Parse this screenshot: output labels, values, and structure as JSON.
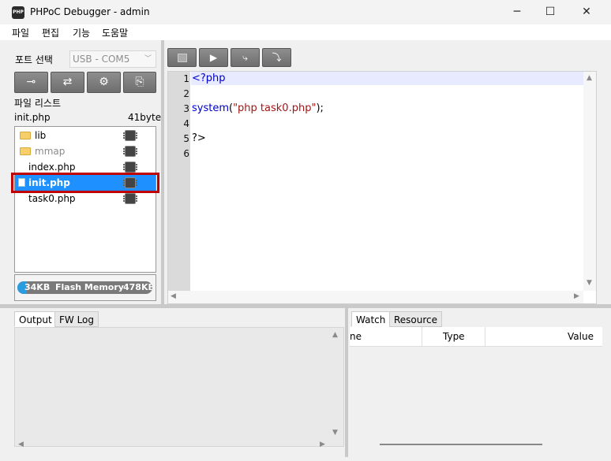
{
  "window": {
    "app_icon_text": "PHP",
    "title": "PHPoC Debugger - admin",
    "minimize": "─",
    "maximize": "☐",
    "close": "✕"
  },
  "menu": {
    "items": [
      "파일",
      "편집",
      "기능",
      "도움말"
    ]
  },
  "port": {
    "label": "포트 선택",
    "value": "USB - COM5"
  },
  "toolbar": {
    "icons": [
      "disconnect-icon",
      "connect-icon",
      "settings-icon",
      "upload-icon"
    ]
  },
  "file_list": {
    "label": "파일 리스트",
    "current_file": "init.php",
    "current_size": "41byte",
    "items": [
      {
        "name": "lib",
        "type": "folder"
      },
      {
        "name": "mmap",
        "type": "folder"
      },
      {
        "name": "index.php",
        "type": "file"
      },
      {
        "name": "init.php",
        "type": "file",
        "selected": true
      },
      {
        "name": "task0.php",
        "type": "file"
      }
    ]
  },
  "flash": {
    "used": "34KB",
    "label": "Flash Memory",
    "total": "478KB",
    "used_fraction": 0.07
  },
  "debug_toolbar": {
    "icons": [
      "stop-icon",
      "run-icon",
      "step-over-icon",
      "step-into-icon"
    ]
  },
  "editor": {
    "line_numbers": [
      "1",
      "2",
      "3",
      "4",
      "5",
      "6"
    ],
    "lines": {
      "l1": "<?php",
      "l3_fn": "system",
      "l3_open": "(",
      "l3_str": "\"php task0.php\"",
      "l3_close": ");",
      "l5": "?>"
    }
  },
  "output_pane": {
    "tabs": [
      "Output",
      "FW Log"
    ]
  },
  "watch_pane": {
    "tabs": [
      "Watch",
      "Resource"
    ],
    "columns": [
      "ne",
      "Type",
      "Value"
    ]
  },
  "colors": {
    "selection": "#1e90ff",
    "highlight_box": "#c00000",
    "keyword": "#0000cc",
    "string": "#a31515"
  }
}
